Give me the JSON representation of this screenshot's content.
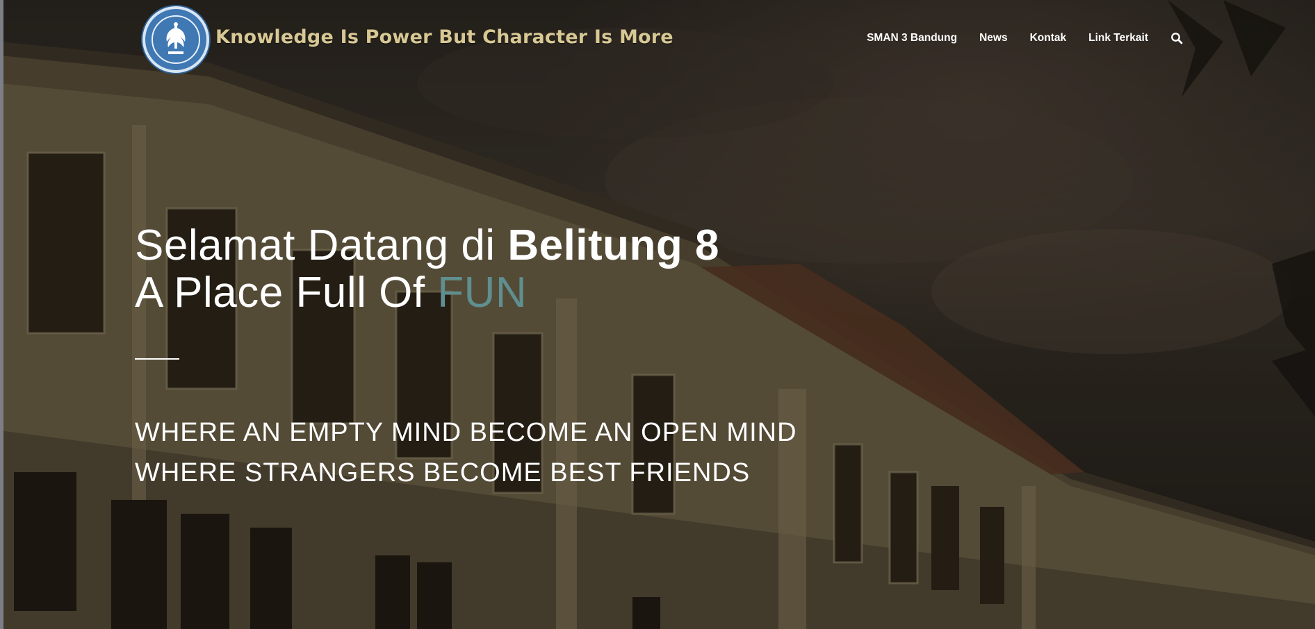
{
  "header": {
    "tagline": "Knowledge Is Power But Character Is More",
    "logo_icon": "school-emblem-icon"
  },
  "nav": {
    "items": [
      {
        "label": "SMAN 3 Bandung"
      },
      {
        "label": "News"
      },
      {
        "label": "Kontak"
      },
      {
        "label": "Link Terkait"
      }
    ],
    "search_icon": "search-icon"
  },
  "hero": {
    "title_line1_prefix": "Selamat Datang di ",
    "title_line1_strong": "Belitung 8",
    "title_line2_prefix": "A Place Full Of ",
    "title_line2_accent": "FUN",
    "subtitle_line1": "WHERE AN EMPTY MIND BECOME AN OPEN MIND",
    "subtitle_line2": "WHERE STRANGERS BECOME BEST FRIENDS"
  },
  "colors": {
    "tagline": "#d7c894",
    "accent": "#5f8f8e",
    "logo_blue": "#3f78b3",
    "text": "#ffffff"
  }
}
